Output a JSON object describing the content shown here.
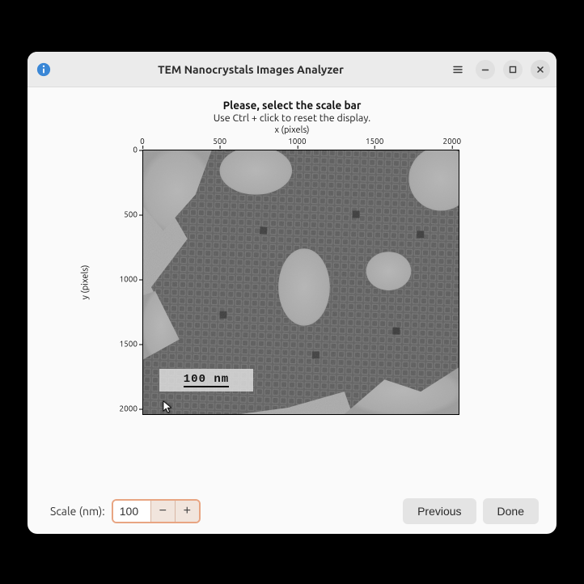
{
  "window": {
    "title": "TEM Nanocrystals Images Analyzer"
  },
  "chart": {
    "title": "Please, select the scale bar",
    "subtitle": "Use Ctrl + click to reset the display.",
    "xlabel": "x (pixels)",
    "ylabel": "y (pixels)",
    "scalebar_text": "100 nm"
  },
  "footer": {
    "scale_label": "Scale (nm):",
    "scale_value": "100",
    "minus": "−",
    "plus": "+",
    "previous": "Previous",
    "done": "Done"
  },
  "chart_data": {
    "type": "image",
    "description": "TEM micrograph of densely packed cuboidal nanocrystals displayed on pixel axes with a 100 nm scale bar overlay",
    "x_ticks": [
      0,
      500,
      1000,
      1500,
      2000
    ],
    "y_ticks": [
      0,
      500,
      1000,
      1500,
      2000
    ],
    "xlim": [
      0,
      2048
    ],
    "ylim": [
      0,
      2048
    ],
    "xlabel": "x (pixels)",
    "ylabel": "y (pixels)",
    "scalebar": {
      "length_nm": 100,
      "label": "100 nm",
      "position": "lower-left"
    }
  }
}
